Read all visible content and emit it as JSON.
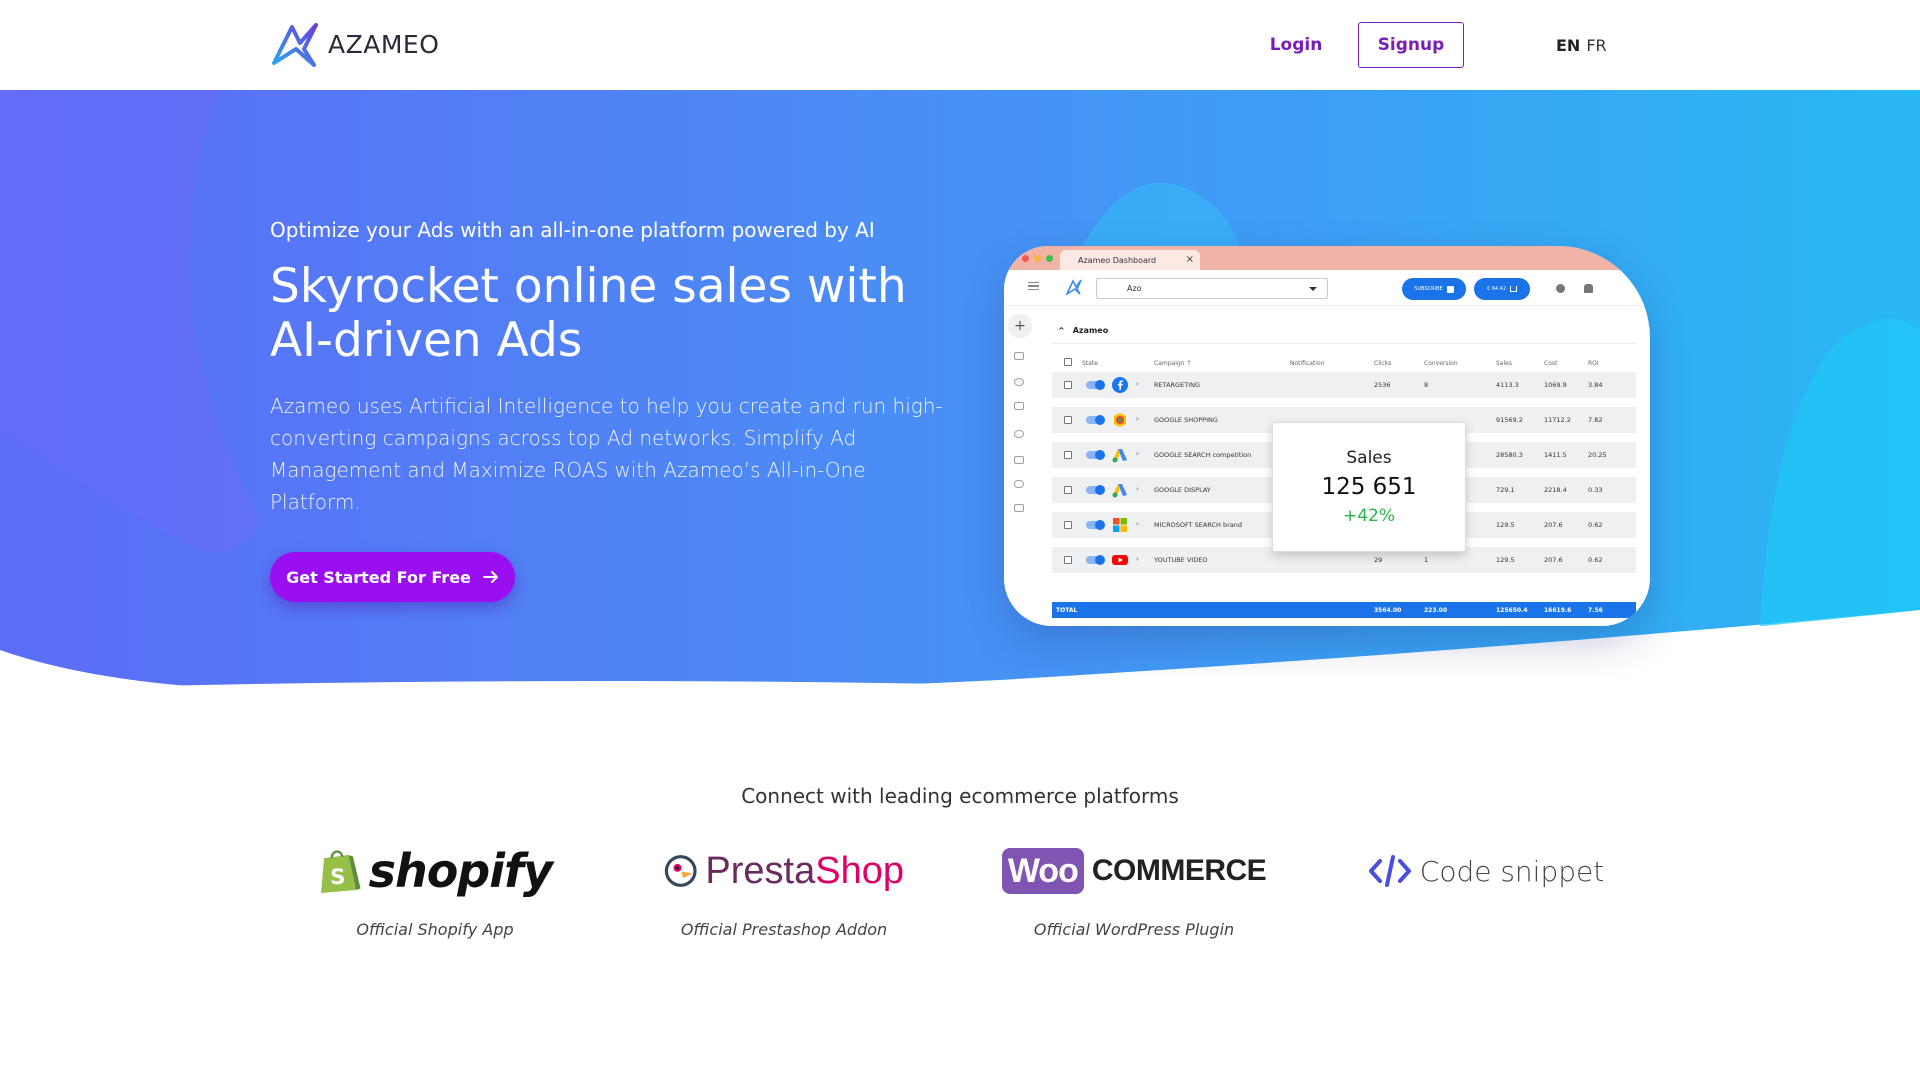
{
  "header": {
    "logo_text": "AZAMEO",
    "login_label": "Login",
    "signup_label": "Signup",
    "lang_active": "EN",
    "lang_other": "FR"
  },
  "hero": {
    "kicker": "Optimize your Ads with an all-in-one platform powered by AI",
    "title_line1": "Skyrocket online sales with",
    "title_line2": "AI-driven Ads",
    "description": "Azameo uses Artificial Intelligence to help you create and run high-converting campaigns across top Ad networks. Simplify Ad Management and Maximize ROAS with Azameo’s All-in-One Platform.",
    "cta_label": "Get Started For Free",
    "cta_icon": "arrow-right-icon"
  },
  "dashboard": {
    "tab_title": "Azameo Dashboard",
    "account_value": "Azo",
    "subscribe_label": "SUBSCRIBE",
    "cart_label": "€ 64.42",
    "section_title": "Azameo",
    "columns": [
      "State",
      "Campaign ↑",
      "Notification",
      "Clicks",
      "Conversion",
      "Sales",
      "Cost",
      "ROI"
    ],
    "rows": [
      {
        "network": "facebook",
        "campaign": "RETARGETING",
        "clicks": "2536",
        "conversion": "8",
        "sales": "4113.3",
        "cost": "1069.9",
        "roi": "3.84"
      },
      {
        "network": "google-shopping",
        "campaign": "GOOGLE SHOPPING",
        "clicks": "",
        "conversion": "",
        "sales": "91569.2",
        "cost": "11712.2",
        "roi": "7.82"
      },
      {
        "network": "google-ads",
        "campaign": "GOOGLE SEARCH competition",
        "clicks": "",
        "conversion": "",
        "sales": "28580.3",
        "cost": "1411.5",
        "roi": "20.25"
      },
      {
        "network": "google-ads",
        "campaign": "GOOGLE DISPLAY",
        "clicks": "",
        "conversion": "",
        "sales": "729.1",
        "cost": "2218.4",
        "roi": "0.33"
      },
      {
        "network": "microsoft",
        "campaign": "MICROSOFT SEARCH brand",
        "clicks": "",
        "conversion": "",
        "sales": "129.5",
        "cost": "207.6",
        "roi": "0.62"
      },
      {
        "network": "youtube",
        "campaign": "YOUTUBE VIDEO",
        "clicks": "29",
        "conversion": "1",
        "sales": "129.5",
        "cost": "207.6",
        "roi": "0.62"
      }
    ],
    "total": {
      "label": "TOTAL",
      "clicks": "3564.00",
      "conversion": "223.00",
      "sales": "125650.4",
      "cost": "16619.6",
      "roi": "7.56"
    },
    "sales_card": {
      "label": "Sales",
      "value": "125 651",
      "delta": "+42%"
    }
  },
  "partners": {
    "title": "Connect with leading ecommerce platforms",
    "items": [
      {
        "name": "shopify",
        "logo_text": "shopify",
        "caption": "Official Shopify App"
      },
      {
        "name": "prestashop",
        "logo_text_a": "Presta",
        "logo_text_b": "Shop",
        "caption": "Official Prestashop Addon"
      },
      {
        "name": "woocommerce",
        "logo_text_a": "Woo",
        "logo_text_b": "COMMERCE",
        "caption": "Official WordPress Plugin"
      },
      {
        "name": "code-snippet",
        "logo_text": "Code snippet",
        "caption": ""
      }
    ]
  },
  "colors": {
    "brand_purple": "#9a0ff2",
    "nav_purple": "#7a1fb4",
    "hero_blue_left": "#5a6cf5",
    "hero_blue_right": "#2ab4f4",
    "dashboard_blue": "#1a73e8"
  }
}
